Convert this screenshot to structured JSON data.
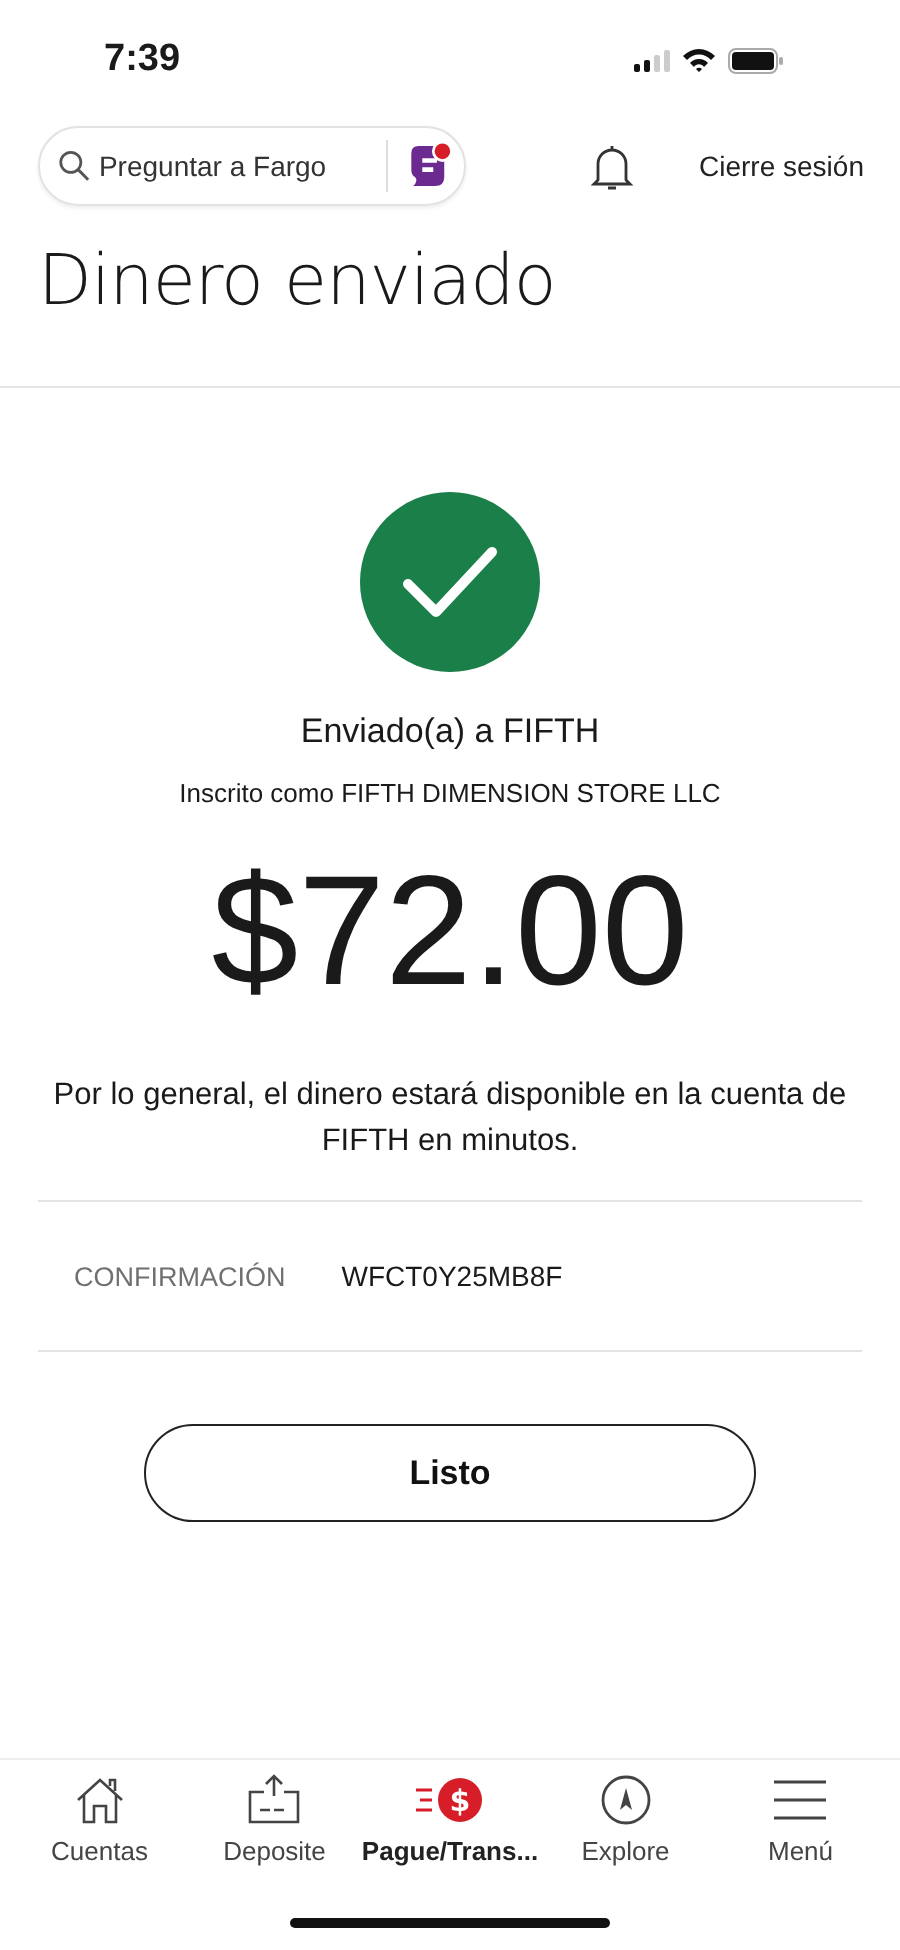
{
  "status_bar": {
    "time": "7:39"
  },
  "header": {
    "search": {
      "placeholder": "Preguntar a Fargo"
    },
    "logout": "Cierre sesión"
  },
  "title": "Dinero enviado",
  "confirmation": {
    "recipient": "Enviado(a) a FIFTH",
    "enrolled_as": "Inscrito como FIFTH DIMENSION STORE LLC",
    "amount": "$72.00",
    "note": "Por lo general, el dinero estará disponible en la cuenta de FIFTH en minutos.",
    "id_label": "CONFIRMACIÓN",
    "id_value": "WFCT0Y25MB8F"
  },
  "done_button": "Listo",
  "tab_bar": [
    {
      "kind": "home",
      "label": "Cuentas",
      "selected": false
    },
    {
      "kind": "deposit",
      "label": "Deposite",
      "selected": false
    },
    {
      "kind": "pay",
      "glyph": "$",
      "label": "Pague/Trans...",
      "selected": true
    },
    {
      "kind": "explore",
      "label": "Explore",
      "selected": false
    },
    {
      "kind": "menu",
      "label": "Menú",
      "selected": false
    }
  ]
}
